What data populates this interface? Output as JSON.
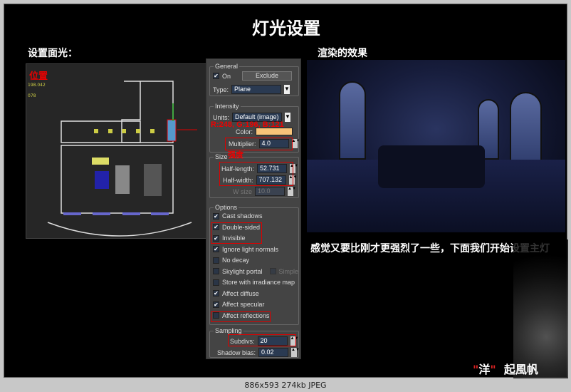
{
  "title": "灯光设置",
  "left_heading": "设置面光：",
  "right_heading": "渲染的效果",
  "viewport": {
    "annot_position": "位置",
    "coords": [
      "198.042",
      "078"
    ]
  },
  "panel": {
    "general": {
      "label": "General",
      "on_label": "On",
      "on": true,
      "exclude_button": "Exclude",
      "type_label": "Type:",
      "type_value": "Plane"
    },
    "intensity": {
      "label": "Intensity",
      "units_label": "Units:",
      "units_value": "Default (image)",
      "color_label": "Color:",
      "color_value": "#f8c479",
      "multiplier_label": "Multiplier:",
      "multiplier_value": "4.0"
    },
    "size": {
      "label": "Size",
      "half_length_label": "Half-length:",
      "half_length_value": "52.731",
      "half_width_label": "Half-width:",
      "half_width_value": "707.132",
      "wsize_label": "W size",
      "wsize_value": "10.0"
    },
    "options": {
      "label": "Options",
      "items": [
        {
          "label": "Cast shadows",
          "checked": true
        },
        {
          "label": "Double-sided",
          "checked": true
        },
        {
          "label": "Invisible",
          "checked": true
        },
        {
          "label": "Ignore light normals",
          "checked": true
        },
        {
          "label": "No decay",
          "checked": false
        },
        {
          "label": "Skylight portal",
          "checked": false
        },
        {
          "label": "Store with irradiance map",
          "checked": false
        },
        {
          "label": "Affect diffuse",
          "checked": true
        },
        {
          "label": "Affect specular",
          "checked": true
        },
        {
          "label": "Affect reflections",
          "checked": false
        }
      ],
      "simple_label": "Simple"
    },
    "sampling": {
      "label": "Sampling",
      "subdivs_label": "Subdivs:",
      "subdivs_value": "20",
      "shadow_bias_label": "Shadow bias:",
      "shadow_bias_value": "0.02"
    }
  },
  "annotations": {
    "rgb": "R:248, G:196, B:121",
    "strength": "强度"
  },
  "description": "感觉又要比刚才更强烈了一些，下面我们开始设置主灯",
  "signature": {
    "quote_open": "\"",
    "name1": "洋",
    "quote_close": "\"",
    "name2": "起風帆"
  },
  "status_bar": "886x593  274kb  JPEG"
}
